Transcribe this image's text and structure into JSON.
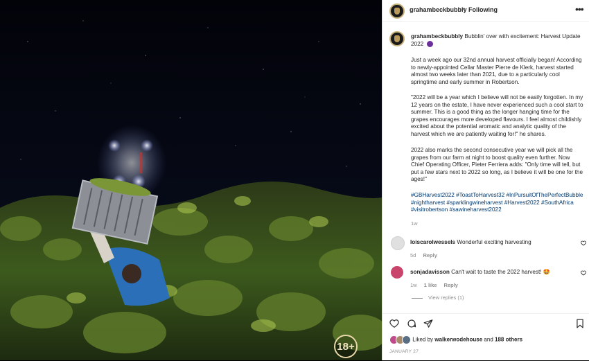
{
  "media": {
    "age_badge": "18+"
  },
  "header": {
    "username": "grahambeckbubbly",
    "separator": "•",
    "follow_status": "Following",
    "more_icon": "more-horizontal-icon"
  },
  "caption": {
    "username": "grahambeckbubbly",
    "headline": "Bubblin' over with excitement: Harvest Update 2022",
    "paragraphs": [
      "Just a week ago our 32nd annual harvest officially began! According to newly-appointed Cellar Master Pierre de Klerk, harvest started almost two weeks later than 2021, due to a particularly cool springtime and early summer in Robertson.",
      "\"2022 will be a year which I believe will not be easily forgotten. In my 12 years on the estate, I have never experienced such a cool start to summer. This is a good thing as the longer hanging time for the grapes encourages more developed flavours. I feel almost childishly excited about the potential aromatic and analytic quality of the harvest which we are patiently waiting for!\" he shares.",
      "2022 also marks the second consecutive year we will pick all the grapes from our farm at night to boost quality even further. Now Chief Operating Officer, Pieter Ferriera adds: \"Only time will tell, but put a few stars next to 2022 so long, as I believe it will be one for the ages!\""
    ],
    "hashtags": "#GBHarvest2022 #ToastToHarvest32 #InPursuitOfThePerfectBubble #nightharvest #sparklingwineharvest #Harvest2022 #SouthAfrica #visitrobertson #sawineharvest2022",
    "time": "1w"
  },
  "comments": [
    {
      "username": "loiscarolwessels",
      "text": "Wonderful exciting harvesting",
      "time": "5d",
      "likes": "",
      "reply": "Reply"
    },
    {
      "username": "sonjadavisson",
      "text": "Can't wait to taste the 2022 harvest! 🤩",
      "time": "1w",
      "likes": "1 like",
      "reply": "Reply",
      "view_replies": "View replies (1)"
    }
  ],
  "actions": {
    "liked_by_prefix": "Liked by",
    "liked_by_user": "walkerwodehouse",
    "liked_by_and": "and",
    "liked_by_others": "188 others",
    "date": "JANUARY 27"
  }
}
